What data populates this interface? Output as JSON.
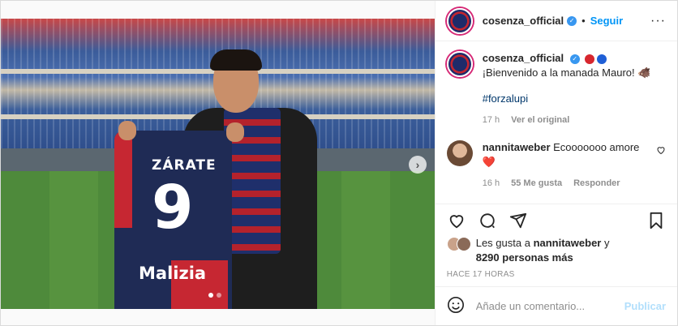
{
  "header": {
    "username": "cosenza_official",
    "separator": "•",
    "follow_label": "Seguir",
    "more_icon": "more-horizontal-icon"
  },
  "photo": {
    "jersey_name": "ZÁRATE",
    "jersey_number": "9",
    "sponsor": "Malizia"
  },
  "caption": {
    "username": "cosenza_official",
    "text": "¡Bienvenido a la manada Mauro! 🐗",
    "hashtag": "#forzalupi",
    "time": "17 h",
    "see_original": "Ver el original"
  },
  "comment": {
    "username": "nannitaweber",
    "text": "Ecooooooo amore",
    "emoji": "❤️",
    "time": "16 h",
    "likes": "55 Me gusta",
    "reply": "Responder"
  },
  "likes": {
    "prefix": "Les gusta a",
    "user": "nannitaweber",
    "suffix": "y",
    "others": "8290 personas más"
  },
  "timeago": "HACE 17 HORAS",
  "add_comment": {
    "placeholder": "Añade un comentario...",
    "publish": "Publicar"
  },
  "colors": {
    "accent": "#0095f6",
    "verified": "#3897f0",
    "red_ball": "#d7262e",
    "blue_ball": "#1f5fd6"
  }
}
